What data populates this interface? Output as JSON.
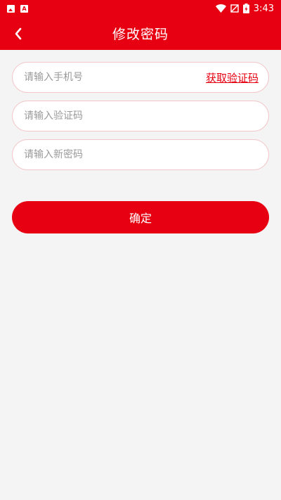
{
  "status_bar": {
    "time": "3:43",
    "icons": [
      "image-icon",
      "font-icon",
      "wifi-icon",
      "no-signal-icon",
      "battery-charging-icon"
    ]
  },
  "nav": {
    "title": "修改密码",
    "back_icon": "chevron-left-icon"
  },
  "form": {
    "phone_placeholder": "请输入手机号",
    "get_code_label": "获取验证码",
    "code_placeholder": "请输入验证码",
    "password_placeholder": "请输入新密码"
  },
  "confirm_label": "确定",
  "colors": {
    "accent": "#e60012",
    "background": "#f4f4f4",
    "field_border": "#f2c5c8"
  }
}
